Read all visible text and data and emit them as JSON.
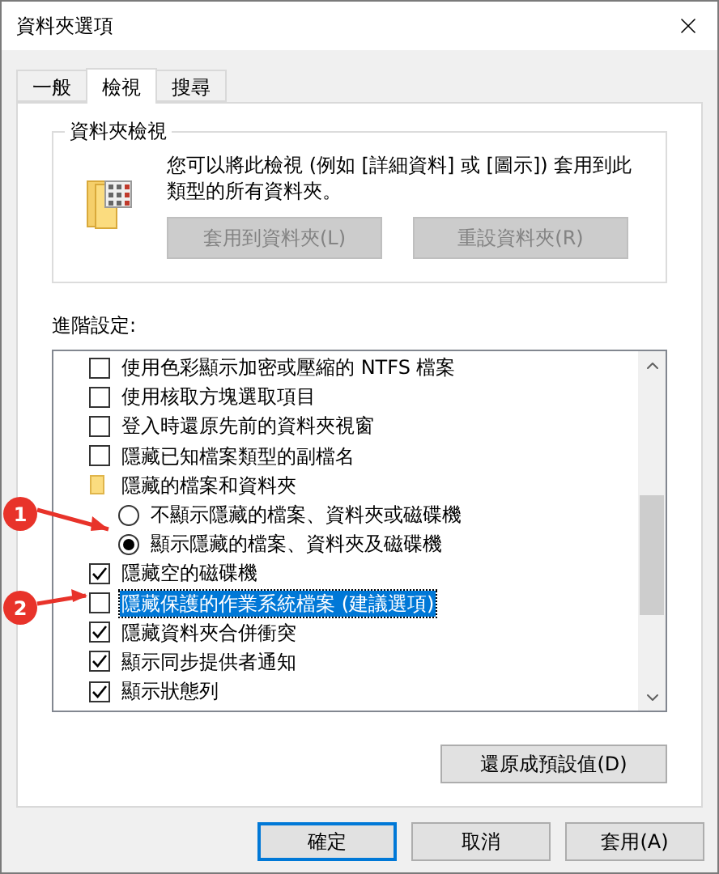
{
  "window": {
    "title": "資料夾選項"
  },
  "tabs": [
    {
      "label": "一般",
      "selected": false
    },
    {
      "label": "檢視",
      "selected": true
    },
    {
      "label": "搜尋",
      "selected": false
    }
  ],
  "folder_views": {
    "title": "資料夾檢視",
    "description": "您可以將此檢視 (例如 [詳細資料] 或 [圖示]) 套用到此類型的所有資料夾。",
    "buttons": [
      {
        "label": "套用到資料夾(L)",
        "disabled": true
      },
      {
        "label": "重設資料夾(R)",
        "disabled": true
      }
    ]
  },
  "advanced": {
    "label": "進階設定:",
    "items": [
      {
        "kind": "checkbox",
        "label": "使用色彩顯示加密或壓縮的 NTFS 檔案",
        "checked": false,
        "selected": false
      },
      {
        "kind": "checkbox",
        "label": "使用核取方塊選取項目",
        "checked": false,
        "selected": false
      },
      {
        "kind": "checkbox",
        "label": "登入時還原先前的資料夾視窗",
        "checked": false,
        "selected": false
      },
      {
        "kind": "checkbox",
        "label": "隱藏已知檔案類型的副檔名",
        "checked": false,
        "selected": false
      },
      {
        "kind": "folder",
        "label": "隱藏的檔案和資料夾",
        "selected": false,
        "children": [
          {
            "kind": "radio",
            "label": "不顯示隱藏的檔案、資料夾或磁碟機",
            "checked": false,
            "selected": false
          },
          {
            "kind": "radio",
            "label": "顯示隱藏的檔案、資料夾及磁碟機",
            "checked": true,
            "selected": false
          }
        ]
      },
      {
        "kind": "checkbox",
        "label": "隱藏空的磁碟機",
        "checked": true,
        "selected": false
      },
      {
        "kind": "checkbox",
        "label": "隱藏保護的作業系統檔案 (建議選項)",
        "checked": false,
        "selected": true
      },
      {
        "kind": "checkbox",
        "label": "隱藏資料夾合併衝突",
        "checked": true,
        "selected": false
      },
      {
        "kind": "checkbox",
        "label": "顯示同步提供者通知",
        "checked": true,
        "selected": false
      },
      {
        "kind": "checkbox",
        "label": "顯示狀態列",
        "checked": true,
        "selected": false
      }
    ],
    "restore_button": "還原成預設值(D)"
  },
  "buttons": [
    {
      "label": "確定",
      "default": true
    },
    {
      "label": "取消",
      "default": false
    },
    {
      "label": "套用(A)",
      "default": false
    }
  ],
  "annotations": [
    {
      "label": "1"
    },
    {
      "label": "2"
    }
  ]
}
